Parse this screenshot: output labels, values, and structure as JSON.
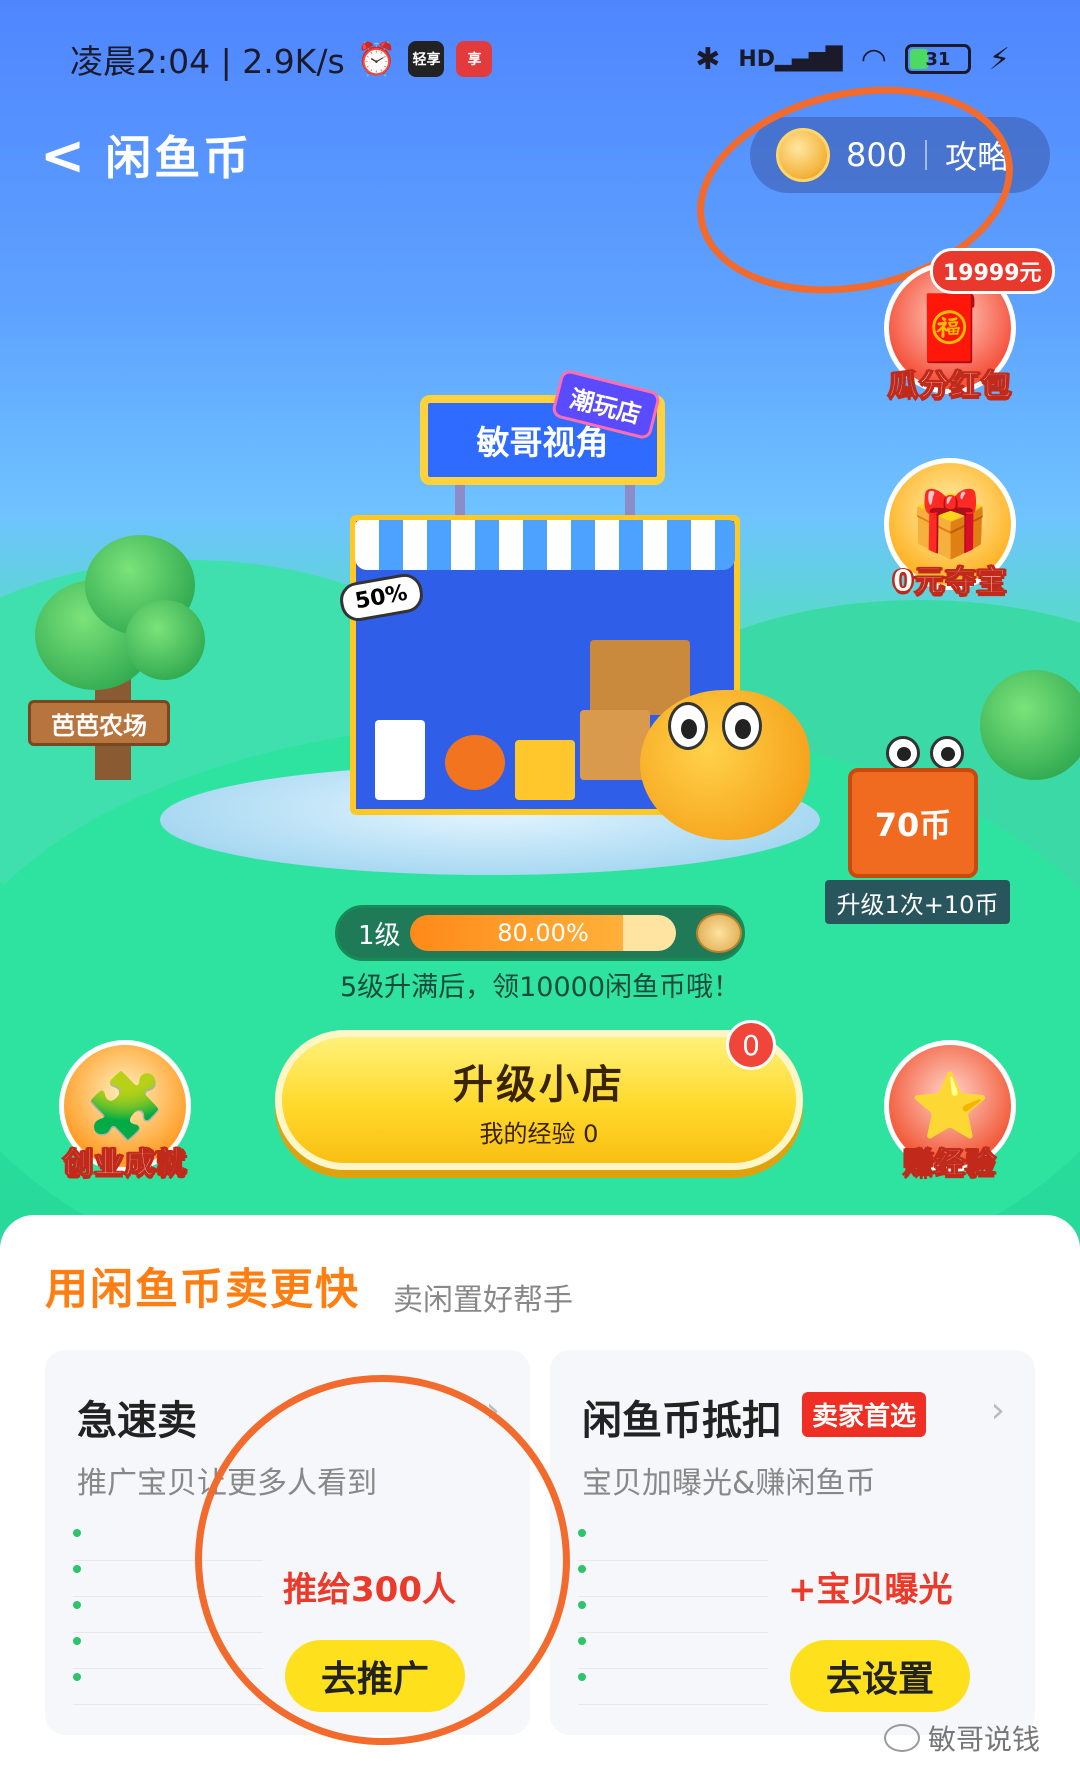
{
  "status_bar": {
    "time_speed": "凌晨2:04 | 2.9K/s",
    "app_tag_1": "轻享",
    "app_tag_2": "享",
    "network": "HD",
    "battery": "31"
  },
  "header": {
    "back": "<",
    "title": "闲鱼币",
    "coin_balance": "800",
    "guide_link": "攻略"
  },
  "side_buttons": {
    "red_packet": {
      "label": "瓜分红包",
      "badge": "19999元",
      "icon": "red-envelope-icon"
    },
    "treasure": {
      "label": "0元夺宝",
      "icon": "treasure-chest-icon"
    },
    "achievement": {
      "label": "创业成就",
      "icon": "puzzle-icon"
    },
    "earn_exp": {
      "label": "赚经验",
      "icon": "star-book-icon"
    }
  },
  "scene": {
    "shop_sign": "敏哥视角",
    "shop_tag": "潮玩店",
    "sale_tag": "50%",
    "farm_sign": "芭芭农场",
    "chest_label": "70币",
    "chest_note": "升级1次+10币"
  },
  "progress": {
    "level": "1级",
    "percent_text": "80.00%",
    "fraction": 0.8,
    "hint": "5级升满后，领10000闲鱼币哦！"
  },
  "upgrade": {
    "label": "升级小店",
    "sub": "我的经验 0",
    "badge": "0"
  },
  "panel": {
    "title": "用闲鱼币卖更快",
    "subtitle": "卖闲置好帮手",
    "cards": [
      {
        "title": "急速卖",
        "desc": "推广宝贝让更多人看到",
        "highlight": "推给300人",
        "cta": "去推广"
      },
      {
        "title": "闲鱼币抵扣",
        "tag": "卖家首选",
        "desc": "宝贝加曝光&赚闲鱼币",
        "highlight": "+宝贝曝光",
        "cta": "去设置"
      }
    ]
  },
  "watermark": "敏哥说钱",
  "colors": {
    "accent_orange": "#ff7e12",
    "cta_yellow": "#ffe01d",
    "highlight_red": "#ec3a2a",
    "annotation_circle": "#f26a2c"
  }
}
